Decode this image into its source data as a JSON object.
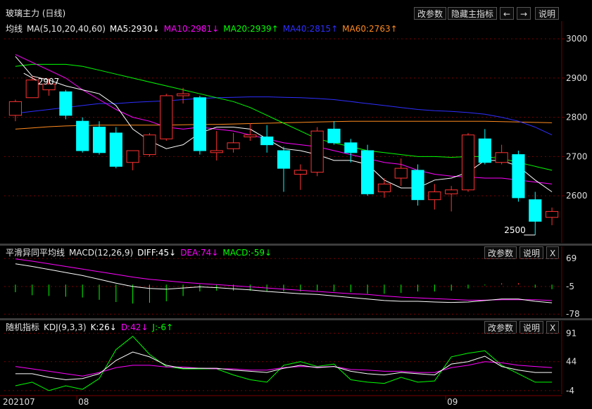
{
  "window": {
    "title": "玻璃主力 (日线)",
    "buttons": [
      "改参数",
      "隐藏主指标",
      "←",
      "→",
      "说明"
    ]
  },
  "colors": {
    "up": "#ff3232",
    "down": "#00ffff",
    "ma5": "#ffffff",
    "ma10": "#ff00ff",
    "ma20": "#00ff00",
    "ma40": "#2e2eff",
    "ma60": "#ff8a1e",
    "dif": "#ffffff",
    "dea": "#ff00ff",
    "k": "#ffffff",
    "d": "#ff00ff",
    "j": "#00ff00",
    "grid": "#7a0000",
    "axis": "#7a0000"
  },
  "main": {
    "legend": {
      "label": "均线",
      "params": "MA(5,10,20,40,60)",
      "ma5": "MA5:2930↓",
      "ma10": "MA10:2981↓",
      "ma20": "MA20:2939↑",
      "ma40": "MA40:2815↑",
      "ma60": "MA60:2763↑"
    },
    "y_ticks": [
      "3000",
      "2900",
      "2800",
      "2700",
      "2600"
    ],
    "annotations": [
      "2907",
      "2500"
    ]
  },
  "macd": {
    "legend": {
      "label": "平滑异同平均线",
      "params": "MACD(12,26,9)",
      "dif": "DIFF:45↓",
      "dea": "DEA:74↓",
      "macd": "MACD:-59↓"
    },
    "buttons": [
      "改参数",
      "说明",
      "X"
    ],
    "y_ticks": [
      "69",
      "-5",
      "-78"
    ]
  },
  "kdj": {
    "legend": {
      "label": "随机指标",
      "params": "KDJ(9,3,3)",
      "k": "K:26↓",
      "d": "D:42↓",
      "j": "J:-6↑"
    },
    "buttons": [
      "改参数",
      "说明",
      "X"
    ],
    "y_ticks": [
      "91",
      "44",
      "-4"
    ]
  },
  "x_axis": {
    "labels": [
      "202107",
      "08",
      "09"
    ]
  },
  "chart_data": {
    "type": "candlestick",
    "title": "玻璃主力 (日线)",
    "ylim": [
      2480,
      3020
    ],
    "candles": [
      {
        "o": 2805,
        "h": 2845,
        "l": 2790,
        "c": 2840
      },
      {
        "o": 2850,
        "h": 2905,
        "l": 2850,
        "c": 2895
      },
      {
        "o": 2870,
        "h": 2900,
        "l": 2855,
        "c": 2885
      },
      {
        "o": 2865,
        "h": 2870,
        "l": 2795,
        "c": 2805
      },
      {
        "o": 2790,
        "h": 2800,
        "l": 2710,
        "c": 2715
      },
      {
        "o": 2775,
        "h": 2790,
        "l": 2705,
        "c": 2710
      },
      {
        "o": 2760,
        "h": 2775,
        "l": 2670,
        "c": 2675
      },
      {
        "o": 2685,
        "h": 2715,
        "l": 2665,
        "c": 2715
      },
      {
        "o": 2705,
        "h": 2760,
        "l": 2700,
        "c": 2755
      },
      {
        "o": 2745,
        "h": 2860,
        "l": 2740,
        "c": 2855
      },
      {
        "o": 2855,
        "h": 2875,
        "l": 2835,
        "c": 2860
      },
      {
        "o": 2850,
        "h": 2855,
        "l": 2705,
        "c": 2715
      },
      {
        "o": 2710,
        "h": 2765,
        "l": 2690,
        "c": 2715
      },
      {
        "o": 2720,
        "h": 2760,
        "l": 2710,
        "c": 2735
      },
      {
        "o": 2750,
        "h": 2785,
        "l": 2740,
        "c": 2755
      },
      {
        "o": 2750,
        "h": 2780,
        "l": 2710,
        "c": 2730
      },
      {
        "o": 2715,
        "h": 2725,
        "l": 2610,
        "c": 2670
      },
      {
        "o": 2655,
        "h": 2680,
        "l": 2615,
        "c": 2665
      },
      {
        "o": 2660,
        "h": 2775,
        "l": 2650,
        "c": 2765
      },
      {
        "o": 2770,
        "h": 2790,
        "l": 2730,
        "c": 2735
      },
      {
        "o": 2735,
        "h": 2745,
        "l": 2685,
        "c": 2710
      },
      {
        "o": 2715,
        "h": 2730,
        "l": 2600,
        "c": 2605
      },
      {
        "o": 2610,
        "h": 2645,
        "l": 2595,
        "c": 2630
      },
      {
        "o": 2645,
        "h": 2695,
        "l": 2625,
        "c": 2670
      },
      {
        "o": 2665,
        "h": 2680,
        "l": 2575,
        "c": 2590
      },
      {
        "o": 2590,
        "h": 2630,
        "l": 2565,
        "c": 2610
      },
      {
        "o": 2605,
        "h": 2625,
        "l": 2560,
        "c": 2615
      },
      {
        "o": 2615,
        "h": 2760,
        "l": 2610,
        "c": 2755
      },
      {
        "o": 2745,
        "h": 2770,
        "l": 2680,
        "c": 2685
      },
      {
        "o": 2685,
        "h": 2730,
        "l": 2680,
        "c": 2710
      },
      {
        "o": 2705,
        "h": 2715,
        "l": 2585,
        "c": 2595
      },
      {
        "o": 2590,
        "h": 2610,
        "l": 2500,
        "c": 2535
      },
      {
        "o": 2545,
        "h": 2570,
        "l": 2525,
        "c": 2560
      }
    ],
    "ma5": [
      2955,
      2905,
      2895,
      2880,
      2870,
      2860,
      2830,
      2770,
      2740,
      2720,
      2730,
      2760,
      2775,
      2775,
      2770,
      2745,
      2720,
      2715,
      2705,
      2690,
      2690,
      2680,
      2640,
      2620,
      2620,
      2640,
      2645,
      2660,
      2690,
      2690,
      2675,
      2640,
      2610
    ],
    "ma10": [
      2960,
      2940,
      2920,
      2900,
      2870,
      2845,
      2820,
      2800,
      2790,
      2775,
      2770,
      2775,
      2770,
      2765,
      2755,
      2745,
      2735,
      2730,
      2725,
      2715,
      2705,
      2695,
      2685,
      2680,
      2665,
      2655,
      2650,
      2648,
      2645,
      2645,
      2640,
      2635,
      2630
    ],
    "ma20": [
      2930,
      2935,
      2935,
      2935,
      2930,
      2920,
      2910,
      2900,
      2890,
      2880,
      2870,
      2860,
      2850,
      2840,
      2825,
      2805,
      2785,
      2765,
      2745,
      2735,
      2725,
      2715,
      2710,
      2705,
      2700,
      2700,
      2698,
      2700,
      2700,
      2695,
      2685,
      2675,
      2665
    ],
    "ma40": [
      2810,
      2815,
      2820,
      2825,
      2830,
      2835,
      2835,
      2838,
      2840,
      2842,
      2845,
      2848,
      2850,
      2851,
      2852,
      2852,
      2851,
      2850,
      2848,
      2845,
      2840,
      2835,
      2830,
      2825,
      2820,
      2817,
      2815,
      2812,
      2808,
      2800,
      2790,
      2775,
      2755
    ],
    "ma60": [
      2770,
      2773,
      2776,
      2778,
      2779,
      2780,
      2780,
      2780,
      2780,
      2780,
      2781,
      2782,
      2782,
      2783,
      2784,
      2785,
      2786,
      2787,
      2788,
      2789,
      2790,
      2790,
      2790,
      2790,
      2790,
      2790,
      2790,
      2790,
      2790,
      2789,
      2788,
      2787,
      2786
    ],
    "macd_ylim": [
      -85,
      75
    ],
    "dif": [
      55,
      48,
      40,
      32,
      24,
      14,
      4,
      -5,
      -10,
      -12,
      -9,
      -6,
      -8,
      -11,
      -14,
      -18,
      -21,
      -24,
      -26,
      -30,
      -34,
      -38,
      -42,
      -44,
      -44,
      -46,
      -47,
      -46,
      -42,
      -38,
      -38,
      -44,
      -48
    ],
    "dea": [
      68,
      62,
      55,
      48,
      41,
      34,
      27,
      20,
      14,
      10,
      6,
      3,
      0,
      -3,
      -6,
      -9,
      -12,
      -15,
      -18,
      -21,
      -24,
      -26,
      -30,
      -33,
      -35,
      -37,
      -39,
      -41,
      -41,
      -40,
      -40,
      -40,
      -42
    ],
    "macd": [
      -20,
      -28,
      -30,
      -32,
      -34,
      -40,
      -46,
      -50,
      -48,
      -44,
      -30,
      -18,
      -16,
      -16,
      -16,
      -18,
      -18,
      -18,
      -16,
      -18,
      -20,
      -24,
      -24,
      -22,
      -18,
      -18,
      -16,
      -10,
      -2,
      4,
      4,
      -8,
      -12
    ],
    "kdj_ylim": [
      -10,
      95
    ],
    "k": [
      24,
      24,
      18,
      14,
      16,
      24,
      46,
      60,
      52,
      38,
      33,
      33,
      33,
      30,
      28,
      26,
      33,
      38,
      34,
      36,
      28,
      24,
      22,
      26,
      24,
      22,
      40,
      44,
      53,
      36,
      30,
      26,
      26
    ],
    "d": [
      36,
      32,
      28,
      24,
      20,
      26,
      34,
      38,
      38,
      35,
      35,
      33,
      32,
      32,
      30,
      30,
      34,
      36,
      35,
      36,
      31,
      30,
      28,
      28,
      26,
      26,
      34,
      38,
      44,
      42,
      38,
      36,
      34
    ],
    "j": [
      4,
      10,
      -4,
      4,
      -2,
      16,
      64,
      86,
      56,
      36,
      32,
      32,
      32,
      22,
      14,
      10,
      38,
      44,
      36,
      40,
      14,
      10,
      8,
      18,
      10,
      12,
      52,
      58,
      62,
      38,
      24,
      10,
      10
    ]
  }
}
